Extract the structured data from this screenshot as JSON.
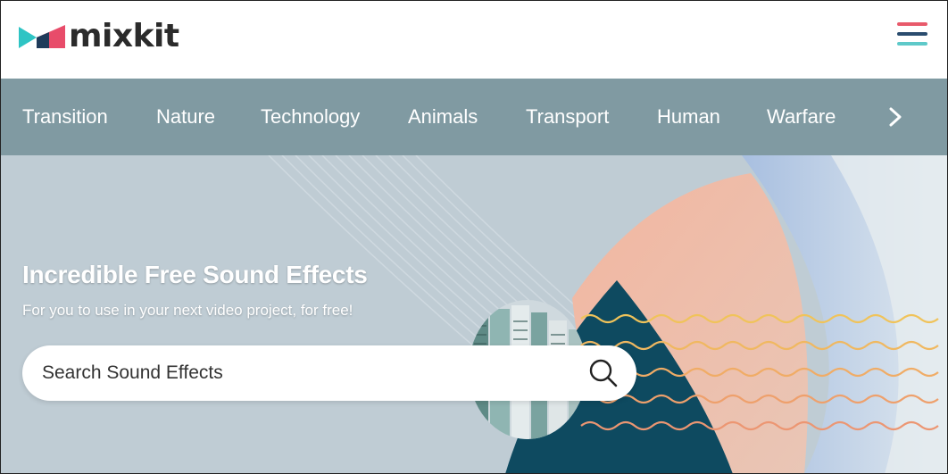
{
  "header": {
    "logo_text": "mixkit",
    "logo_colors": [
      "#2ec4c4",
      "#e84c6a",
      "#1e3b5a"
    ],
    "menu_icon": "hamburger-menu-icon",
    "menu_colors": [
      "#e85a6b",
      "#2a4c6e",
      "#5ec9c9"
    ]
  },
  "categories": {
    "items": [
      "Transition",
      "Nature",
      "Technology",
      "Animals",
      "Transport",
      "Human",
      "Warfare"
    ],
    "next_icon": "chevron-right-icon",
    "background": "#809aa2"
  },
  "hero": {
    "title": "Incredible Free Sound Effects",
    "subtitle": "For you to use in your next video project, for free!",
    "search": {
      "placeholder": "Search Sound Effects",
      "value": "",
      "icon": "search-icon"
    }
  }
}
